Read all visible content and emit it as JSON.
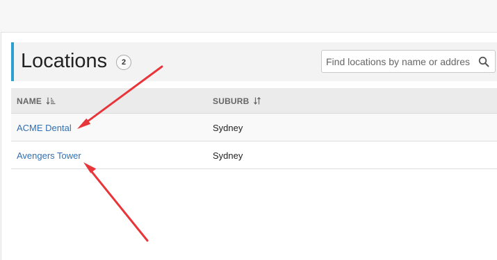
{
  "header": {
    "title": "Locations",
    "count": "2"
  },
  "search": {
    "placeholder": "Find locations by name or addres",
    "value": ""
  },
  "table": {
    "columns": [
      {
        "label": "NAME",
        "sort_icon": "sort-amount-asc-icon"
      },
      {
        "label": "SUBURB",
        "sort_icon": "sort-icon"
      }
    ],
    "rows": [
      {
        "name": "ACME Dental",
        "suburb": "Sydney"
      },
      {
        "name": "Avengers Tower",
        "suburb": "Sydney"
      }
    ]
  },
  "annotations": {
    "arrow_color": "#e8353a"
  },
  "colors": {
    "accent": "#2da0d2",
    "link": "#2f6fb4"
  }
}
